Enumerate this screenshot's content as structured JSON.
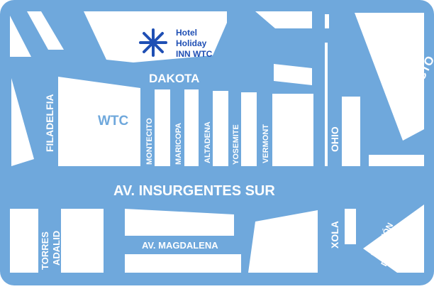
{
  "colors": {
    "street": "#6fa8dc",
    "block": "#ffffff",
    "street_label": "#ffffff",
    "block_label": "#6fa8dc",
    "hotel": "#1f4fb4"
  },
  "hotel": {
    "icon": "asterisk-star-icon",
    "name_lines": [
      "Hotel",
      "Holiday",
      "INN WTC"
    ]
  },
  "landmarks": {
    "wtc": "WTC"
  },
  "streets": {
    "main_avenue": "AV. INSURGENTES SUR",
    "dakota": "DAKOTA",
    "viaducto": "VIADUCTO",
    "filadelfia": "FILADELFIA",
    "montecito": "MONTECITO",
    "maricopa": "MARICOPA",
    "altadena": "ALTADENA",
    "yosemite": "YOSEMITE",
    "vermont": "VERMONT",
    "ohio": "OHIO",
    "torres_adalid_lines": [
      "TORRES",
      "ADALID"
    ],
    "magdalena": "AV. MAGDALENA",
    "xola": "XOLA",
    "division_del_norte_lines": [
      "DIVISIÓN",
      "DEL NORTE"
    ]
  }
}
